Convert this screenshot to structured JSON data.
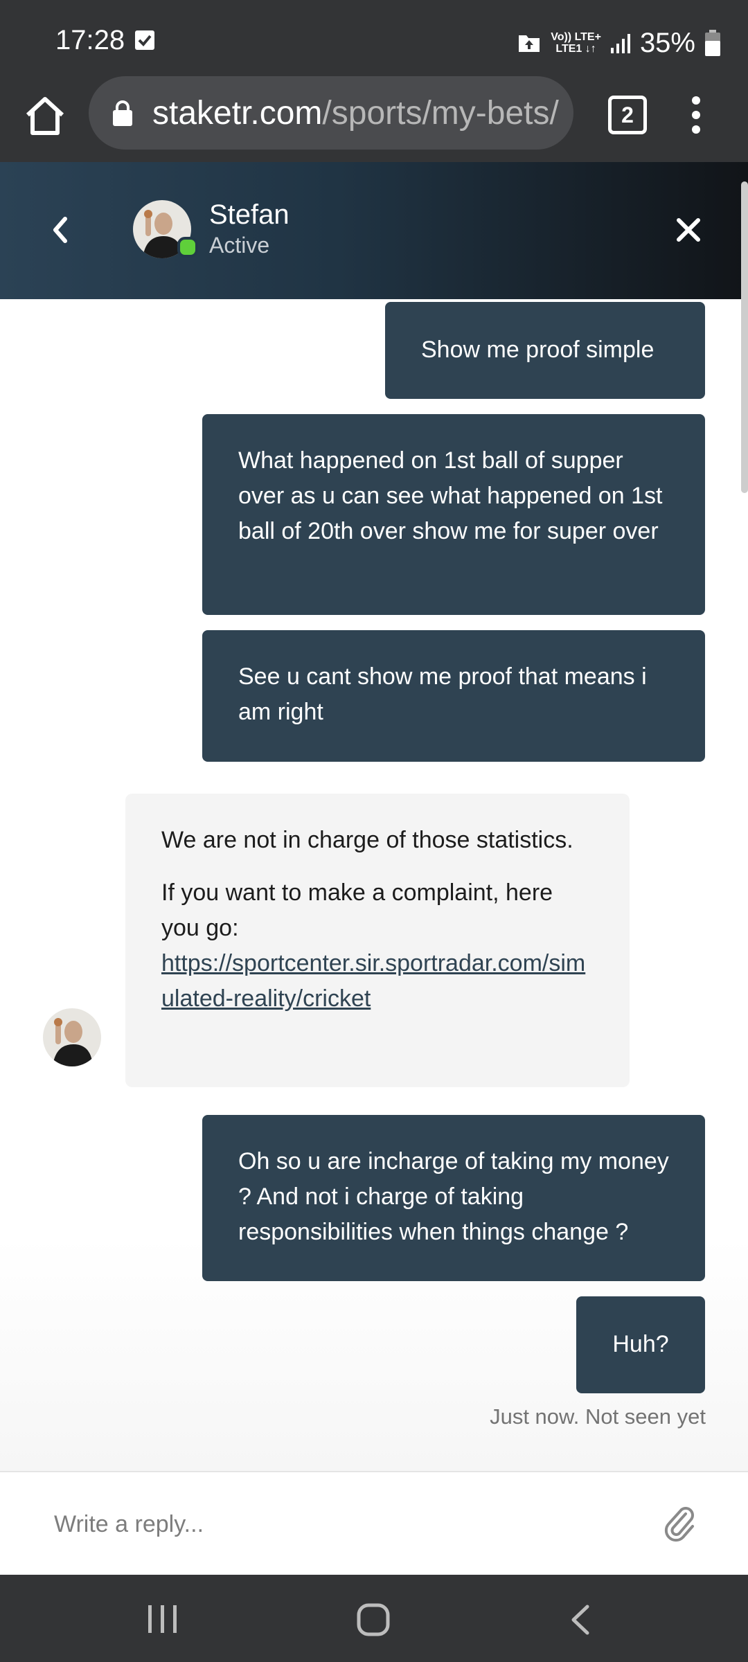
{
  "status_bar": {
    "time": "17:28",
    "network_top": "Vo)) LTE+",
    "network_bottom": "LTE1 ↓↑",
    "battery": "35%"
  },
  "browser": {
    "url_host": "staketr.com",
    "url_path": "/sports/my-bets/",
    "tab_count": "2"
  },
  "chat_header": {
    "agent_name": "Stefan",
    "agent_status": "Active"
  },
  "messages": [
    {
      "from": "user",
      "text": "Show me proof simple"
    },
    {
      "from": "user",
      "text": "What happened on 1st ball of supper over as u can see what happened on 1st ball of 20th over show me for super over"
    },
    {
      "from": "user",
      "text": "See u cant show me proof that means i am right"
    },
    {
      "from": "agent",
      "paragraphs": [
        "We are not in charge of those statistics.",
        "If you want to make a complaint, here you go:"
      ],
      "link": "https://sportcenter.sir.sportradar.com/simulated-reality/cricket"
    },
    {
      "from": "user",
      "text": "Oh so u are incharge of taking my money ? And not i charge of taking responsibilities when things change ?"
    },
    {
      "from": "user",
      "text": "Huh?"
    }
  ],
  "message_status": "Just now. Not seen yet",
  "composer": {
    "placeholder": "Write a reply..."
  },
  "colors": {
    "outgoing_bubble": "#2f4352",
    "incoming_bubble": "#f4f4f4",
    "online": "#5fcf3a"
  }
}
